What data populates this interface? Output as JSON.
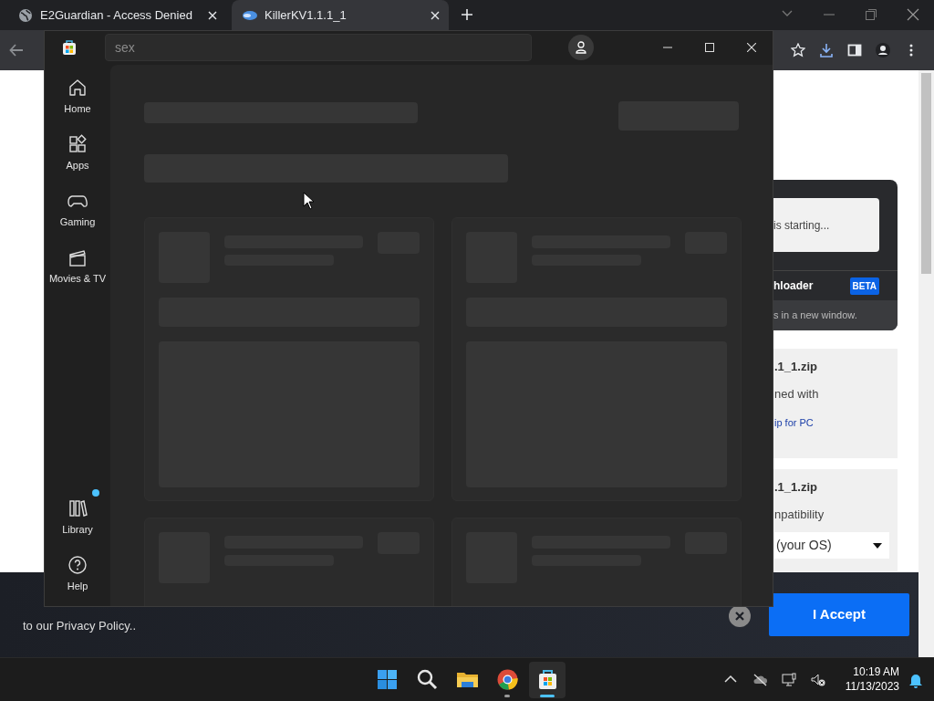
{
  "browser": {
    "tabs": [
      {
        "title": "E2Guardian - Access Denied",
        "selected": false
      },
      {
        "title": "KillerKV1.1.1_1",
        "selected": true
      }
    ]
  },
  "web_page": {
    "download_card": {
      "status": "is starting...",
      "downloader": "hloader",
      "badge": "BETA",
      "note": "s in a new window."
    },
    "file_cards": [
      {
        "kind": "link",
        "filename": ".1_1.zip",
        "line": "ned with",
        "link": "ip for PC"
      },
      {
        "kind": "select",
        "filename": ".1_1.zip",
        "line": "npatibility",
        "select_value": "(your OS)"
      }
    ]
  },
  "cookie_banner": {
    "text": "to our Privacy Policy..",
    "accept_button": "I Accept"
  },
  "store_window": {
    "search": {
      "value": "sex"
    },
    "nav": [
      {
        "label": "Home",
        "kind": "home",
        "notification": false
      },
      {
        "label": "Apps",
        "kind": "apps",
        "notification": false
      },
      {
        "label": "Gaming",
        "kind": "gaming",
        "notification": false
      },
      {
        "label": "Movies & TV",
        "kind": "movies",
        "notification": false
      },
      {
        "label": "Library",
        "kind": "library",
        "notification": true
      },
      {
        "label": "Help",
        "kind": "help",
        "notification": false
      }
    ]
  },
  "taskbar": {
    "apps": [
      {
        "kind": "start",
        "running": false,
        "active": false
      },
      {
        "kind": "search",
        "running": false,
        "active": false
      },
      {
        "kind": "files",
        "running": false,
        "active": false
      },
      {
        "kind": "browser",
        "running": true,
        "active": false
      },
      {
        "kind": "store",
        "running": true,
        "active": true
      }
    ],
    "clock": {
      "time": "10:19 AM",
      "date": "11/13/2023"
    }
  }
}
